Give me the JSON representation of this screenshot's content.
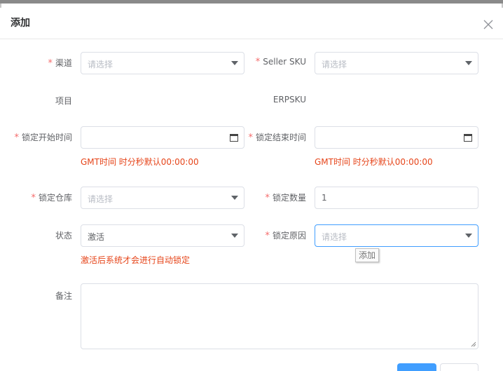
{
  "dialog": {
    "title": "添加"
  },
  "form": {
    "channel": {
      "label": "渠道",
      "placeholder": "请选择"
    },
    "seller_sku": {
      "label": "Seller SKU",
      "placeholder": "请选择"
    },
    "project": {
      "label": "项目",
      "value": ""
    },
    "erpsku": {
      "label": "ERPSKU",
      "value": ""
    },
    "lock_start": {
      "label": "锁定开始时间",
      "value": "",
      "hint": "GMT时间 时分秒默认00:00:00"
    },
    "lock_end": {
      "label": "锁定结束时间",
      "value": "",
      "hint": "GMT时间 时分秒默认00:00:00"
    },
    "lock_warehouse": {
      "label": "锁定仓库",
      "placeholder": "请选择"
    },
    "lock_quantity": {
      "label": "锁定数量",
      "value": "1"
    },
    "status": {
      "label": "状态",
      "value": "激活",
      "hint": "激活后系统才会进行自动锁定"
    },
    "lock_reason": {
      "label": "锁定原因",
      "placeholder": "请选择",
      "tooltip": "添加"
    },
    "remark": {
      "label": "备注",
      "value": ""
    }
  }
}
